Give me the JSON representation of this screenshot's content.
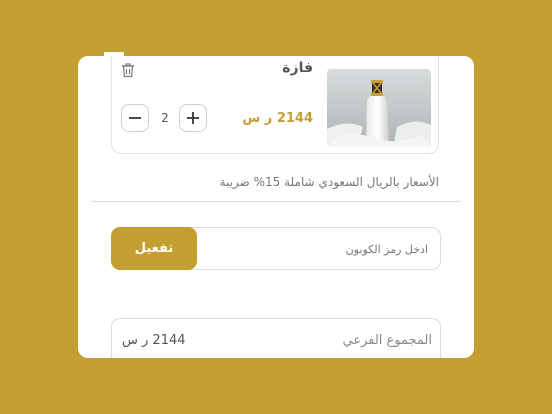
{
  "cart": {
    "product_name": "فازة",
    "product_price": "2144 ر س",
    "quantity": "2",
    "icons": {
      "trash": "trash-icon",
      "minus": "minus-icon",
      "plus": "plus-icon"
    }
  },
  "vat_note": "الأسعار بالريال السعودي شاملة 15% ضريبة",
  "coupon": {
    "placeholder": "ادخل رمز الكوبون",
    "apply_label": "تفعيل"
  },
  "summary": {
    "subtotal_label": "المجموع الفرعي",
    "subtotal_value": "2144 ر س"
  },
  "colors": {
    "background": "#c39f32",
    "accent": "#c39f32",
    "card_border": "#e2e2e2"
  }
}
